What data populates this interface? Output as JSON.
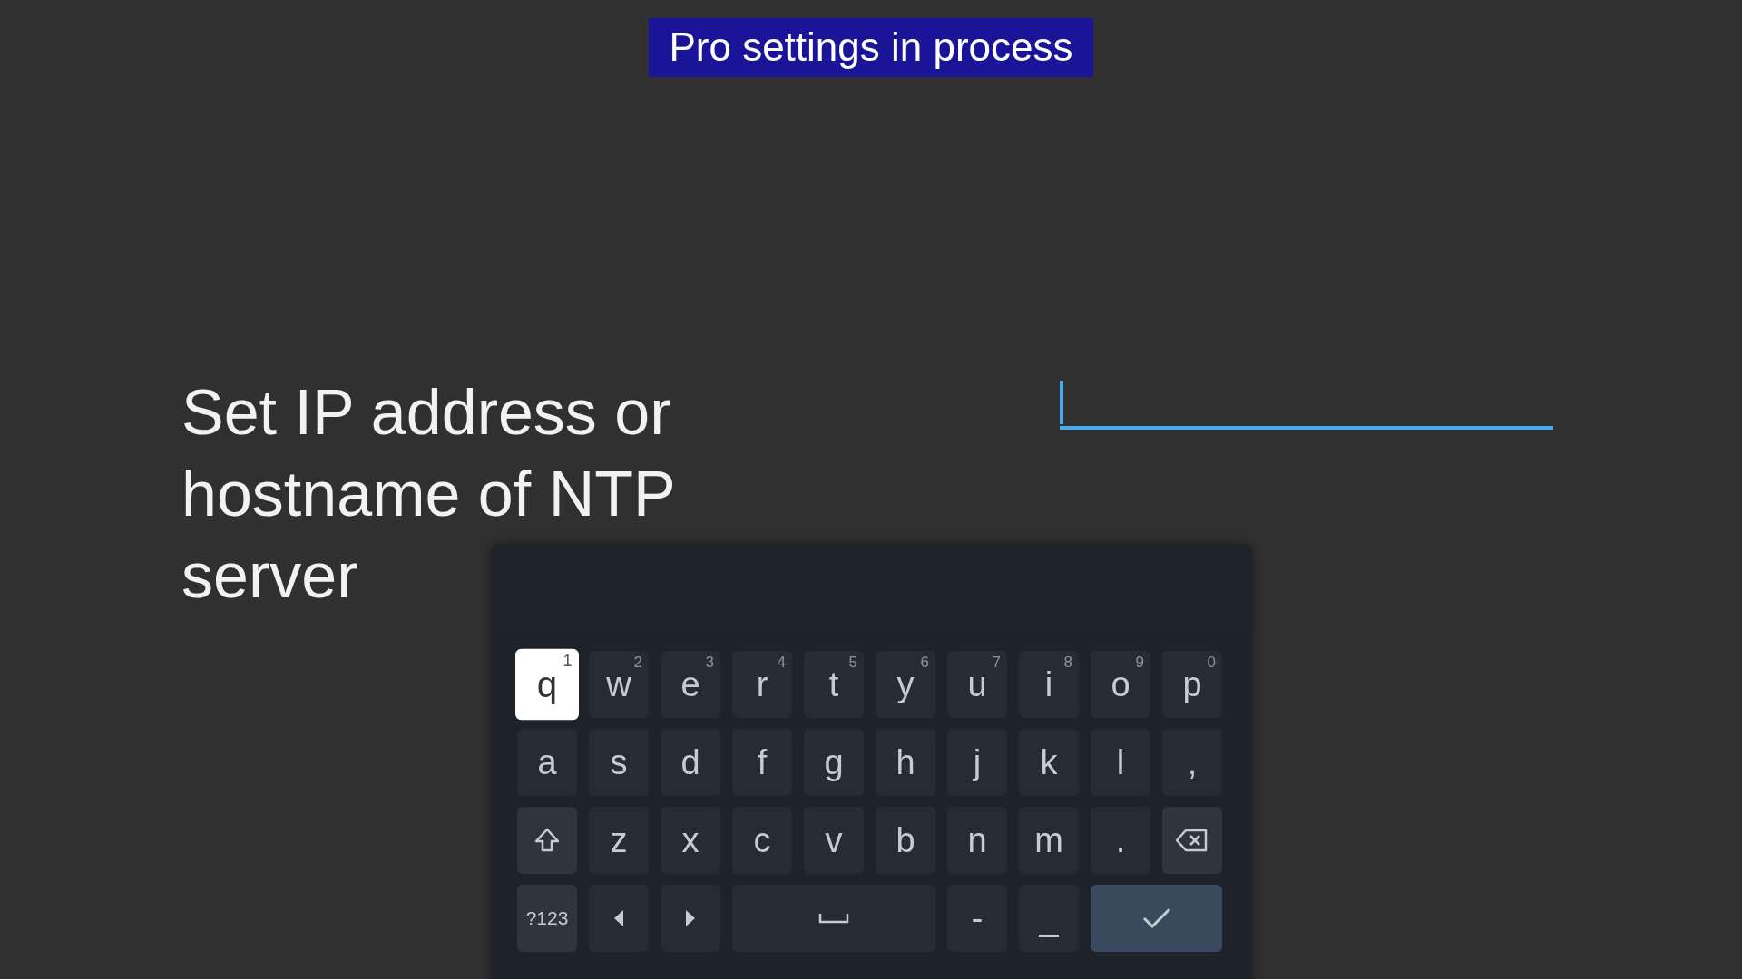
{
  "banner": {
    "text": "Pro settings in process"
  },
  "prompt": {
    "text": "Set IP address or hostname of NTP server"
  },
  "field": {
    "focused": true
  },
  "keyboard": {
    "keys": [
      {
        "kind": "char",
        "label": "q",
        "hint": "1",
        "selected": true
      },
      {
        "kind": "char",
        "label": "w",
        "hint": "2",
        "selected": false
      },
      {
        "kind": "char",
        "label": "e",
        "hint": "3",
        "selected": false
      },
      {
        "kind": "char",
        "label": "r",
        "hint": "4",
        "selected": false
      },
      {
        "kind": "char",
        "label": "t",
        "hint": "5",
        "selected": false
      },
      {
        "kind": "char",
        "label": "y",
        "hint": "6",
        "selected": false
      },
      {
        "kind": "char",
        "label": "u",
        "hint": "7",
        "selected": false
      },
      {
        "kind": "char",
        "label": "i",
        "hint": "8",
        "selected": false
      },
      {
        "kind": "char",
        "label": "o",
        "hint": "9",
        "selected": false
      },
      {
        "kind": "char",
        "label": "p",
        "hint": "0",
        "selected": false
      },
      {
        "kind": "char",
        "label": "a",
        "selected": false
      },
      {
        "kind": "char",
        "label": "s",
        "selected": false
      },
      {
        "kind": "char",
        "label": "d",
        "selected": false
      },
      {
        "kind": "char",
        "label": "f",
        "selected": false
      },
      {
        "kind": "char",
        "label": "g",
        "selected": false
      },
      {
        "kind": "char",
        "label": "h",
        "selected": false
      },
      {
        "kind": "char",
        "label": "j",
        "selected": false
      },
      {
        "kind": "char",
        "label": "k",
        "selected": false
      },
      {
        "kind": "char",
        "label": "l",
        "selected": false
      },
      {
        "kind": "char",
        "label": ",",
        "selected": false
      },
      {
        "kind": "shift",
        "selected": false
      },
      {
        "kind": "char",
        "label": "z",
        "selected": false
      },
      {
        "kind": "char",
        "label": "x",
        "selected": false
      },
      {
        "kind": "char",
        "label": "c",
        "selected": false
      },
      {
        "kind": "char",
        "label": "v",
        "selected": false
      },
      {
        "kind": "char",
        "label": "b",
        "selected": false
      },
      {
        "kind": "char",
        "label": "n",
        "selected": false
      },
      {
        "kind": "char",
        "label": "m",
        "selected": false
      },
      {
        "kind": "char",
        "label": ".",
        "selected": false
      },
      {
        "kind": "backspace",
        "selected": false
      },
      {
        "kind": "symbols",
        "label": "?123",
        "selected": false
      },
      {
        "kind": "left",
        "selected": false
      },
      {
        "kind": "right",
        "selected": false
      },
      {
        "kind": "space",
        "selected": false
      },
      {
        "kind": "char",
        "label": "-",
        "selected": false
      },
      {
        "kind": "char",
        "label": "_",
        "selected": false
      },
      {
        "kind": "enter",
        "selected": false
      }
    ]
  }
}
